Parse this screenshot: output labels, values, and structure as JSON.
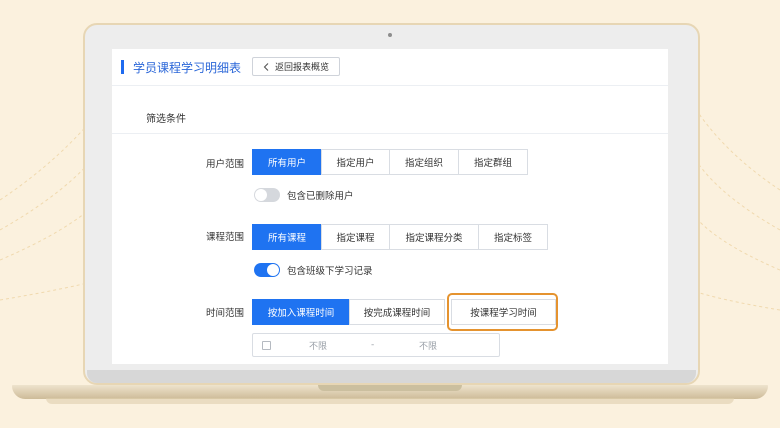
{
  "page": {
    "title": "学员课程学习明细表",
    "back_label": "返回报表概览",
    "filter_title": "筛选条件"
  },
  "user_scope": {
    "label": "用户范围",
    "options": [
      "所有用户",
      "指定用户",
      "指定组织",
      "指定群组"
    ],
    "selected": 0,
    "toggle": {
      "label": "包含已删除用户",
      "on": false
    }
  },
  "course_scope": {
    "label": "课程范围",
    "options": [
      "所有课程",
      "指定课程",
      "指定课程分类",
      "指定标签"
    ],
    "selected": 0,
    "toggle": {
      "label": "包含班级下学习记录",
      "on": true
    }
  },
  "time_scope": {
    "label": "时间范围",
    "options": [
      "按加入课程时间",
      "按完成课程时间",
      "按课程学习时间"
    ],
    "selected": 0,
    "highlighted": 2,
    "date_range": {
      "start": "不限",
      "separator": "-",
      "end": "不限"
    }
  },
  "colors": {
    "accent": "#1f73f1",
    "highlight_border": "#e5932f",
    "background": "#fbf1de"
  },
  "icons": {
    "back": "chevron-left-icon",
    "calendar": "calendar-icon"
  }
}
